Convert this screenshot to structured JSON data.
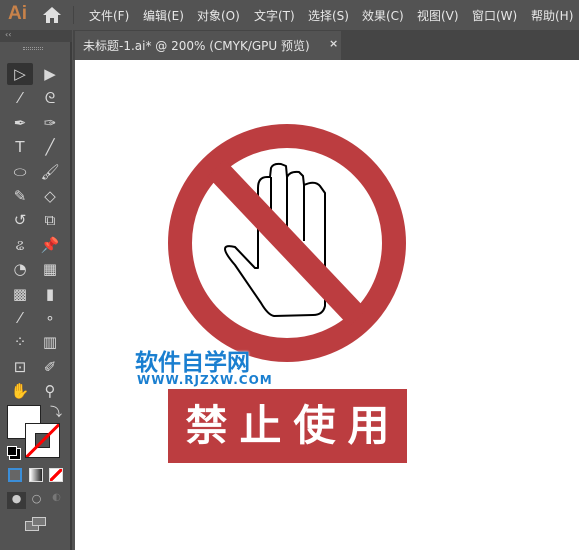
{
  "app": {
    "logo": "Ai",
    "home_icon": "home-icon"
  },
  "menu": [
    "文件(F)",
    "编辑(E)",
    "对象(O)",
    "文字(T)",
    "选择(S)",
    "效果(C)",
    "视图(V)",
    "窗口(W)",
    "帮助(H)"
  ],
  "document_tab": {
    "title": "未标题-1.ai* @ 200% (CMYK/GPU 预览)",
    "close": "×"
  },
  "toolbar": {
    "collapse": "‹‹",
    "tools": [
      {
        "name": "selection-tool",
        "glyph": "▷"
      },
      {
        "name": "direct-selection-tool",
        "glyph": "▶"
      },
      {
        "name": "magic-wand-tool",
        "glyph": "⁄"
      },
      {
        "name": "lasso-tool",
        "glyph": "ᘓ"
      },
      {
        "name": "pen-tool",
        "glyph": "✒"
      },
      {
        "name": "curvature-tool",
        "glyph": "✑"
      },
      {
        "name": "type-tool",
        "glyph": "T"
      },
      {
        "name": "line-tool",
        "glyph": "╱"
      },
      {
        "name": "ellipse-tool",
        "glyph": "⬭"
      },
      {
        "name": "paintbrush-tool",
        "glyph": "🖌"
      },
      {
        "name": "shaper-tool",
        "glyph": "✎"
      },
      {
        "name": "eraser-tool",
        "glyph": "◇"
      },
      {
        "name": "rotate-tool",
        "glyph": "↺"
      },
      {
        "name": "scale-tool",
        "glyph": "⧉"
      },
      {
        "name": "warp-tool",
        "glyph": "ଌ"
      },
      {
        "name": "puppet-warp-tool",
        "glyph": "📌"
      },
      {
        "name": "shape-builder-tool",
        "glyph": "◔"
      },
      {
        "name": "perspective-grid-tool",
        "glyph": "▦"
      },
      {
        "name": "mesh-tool",
        "glyph": "▩"
      },
      {
        "name": "gradient-tool",
        "glyph": "▮"
      },
      {
        "name": "eyedropper-tool",
        "glyph": "⁄"
      },
      {
        "name": "blend-tool",
        "glyph": "∘"
      },
      {
        "name": "symbol-sprayer-tool",
        "glyph": "⁘"
      },
      {
        "name": "column-graph-tool",
        "glyph": "▥"
      },
      {
        "name": "artboard-tool",
        "glyph": "⊡"
      },
      {
        "name": "slice-tool",
        "glyph": "✐"
      },
      {
        "name": "hand-tool",
        "glyph": "✋"
      },
      {
        "name": "zoom-tool",
        "glyph": "⚲"
      }
    ]
  },
  "colors": {
    "fill": "#ffffff",
    "stroke": "none",
    "sign_red": "#bc3d40",
    "watermark_blue": "#1a7fd0"
  },
  "artwork": {
    "banner_text": "禁止使用",
    "watermark_title": "软件自学网",
    "watermark_url": "WWW.RJZXW.COM"
  }
}
